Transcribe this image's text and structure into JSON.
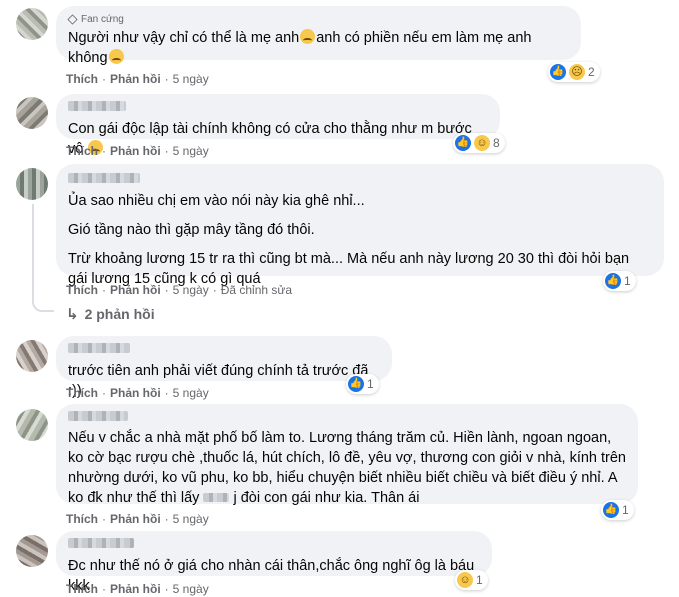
{
  "comments": [
    {
      "badge": "Fan cứng",
      "lines": [
        "Người như vậy chỉ có thể là mẹ anh",
        "anh có phiền nếu em làm mẹ anh không"
      ],
      "like_label": "Thích",
      "reply_label": "Phản hồi",
      "time": "5 ngày",
      "reaction_count": "2",
      "reaction_icons": [
        "like-icon",
        "sad-icon"
      ]
    },
    {
      "lines": [
        "Con gái độc lập tài chính không có cửa cho thằng như m bước vô"
      ],
      "like_label": "Thích",
      "reply_label": "Phản hồi",
      "time": "5 ngày",
      "reaction_count": "8",
      "reaction_icons": [
        "like-icon",
        "haha-icon"
      ]
    },
    {
      "lines": [
        "Ủa sao nhiều chị em vào nói này kia ghê nhỉ...",
        "Gió tầng nào thì gặp mây tầng đó thôi.",
        "Trừ khoảng lương 15 tr ra thì cũng bt mà... Mà nếu anh này lương 20 30 thì đòi hỏi bạn gái lương 15 cũng k có gì quá"
      ],
      "like_label": "Thích",
      "reply_label": "Phản hồi",
      "time": "5 ngày",
      "edited": "Đã chỉnh sửa",
      "reaction_count": "1",
      "reaction_icons": [
        "like-icon"
      ],
      "replies_label": "2 phản hồi"
    },
    {
      "lines": [
        "trước tiên anh phải viết đúng chính tả trước đã :))"
      ],
      "like_label": "Thích",
      "reply_label": "Phản hồi",
      "time": "5 ngày",
      "reaction_count": "1",
      "reaction_icons": [
        "like-icon"
      ]
    },
    {
      "lines": [
        "Nếu v chắc a nhà mặt phố bố làm to. Lương tháng trăm củ. Hiền lành, ngoan ngoan, ko cờ bạc rượu chè ,thuốc lá, hút chích, lô đề, yêu vợ, thương con giỏi v nhà, kính trên nhường dưới, ko vũ phu, ko bb, hiểu chuyện biết nhiều biết chiều và biết điều ý nhỉ. A ko đk như thế thì lấy",
        "j đòi con gái như kia. Thân ái"
      ],
      "like_label": "Thích",
      "reply_label": "Phản hồi",
      "time": "5 ngày",
      "reaction_count": "1",
      "reaction_icons": [
        "like-icon"
      ]
    },
    {
      "lines": [
        "Đc như thế nó ở giá cho nhàn cái thân,chắc ông nghĩ ôg là báu kkk"
      ],
      "like_label": "Thích",
      "reply_label": "Phản hồi",
      "time": "5 ngày",
      "reaction_count": "1",
      "reaction_icons": [
        "haha-icon"
      ]
    }
  ],
  "colors": {
    "bubble": "#f0f2f5",
    "meta": "#65676b",
    "like_blue": "#1b74e4",
    "emoji_yellow": "#f7c84b"
  }
}
